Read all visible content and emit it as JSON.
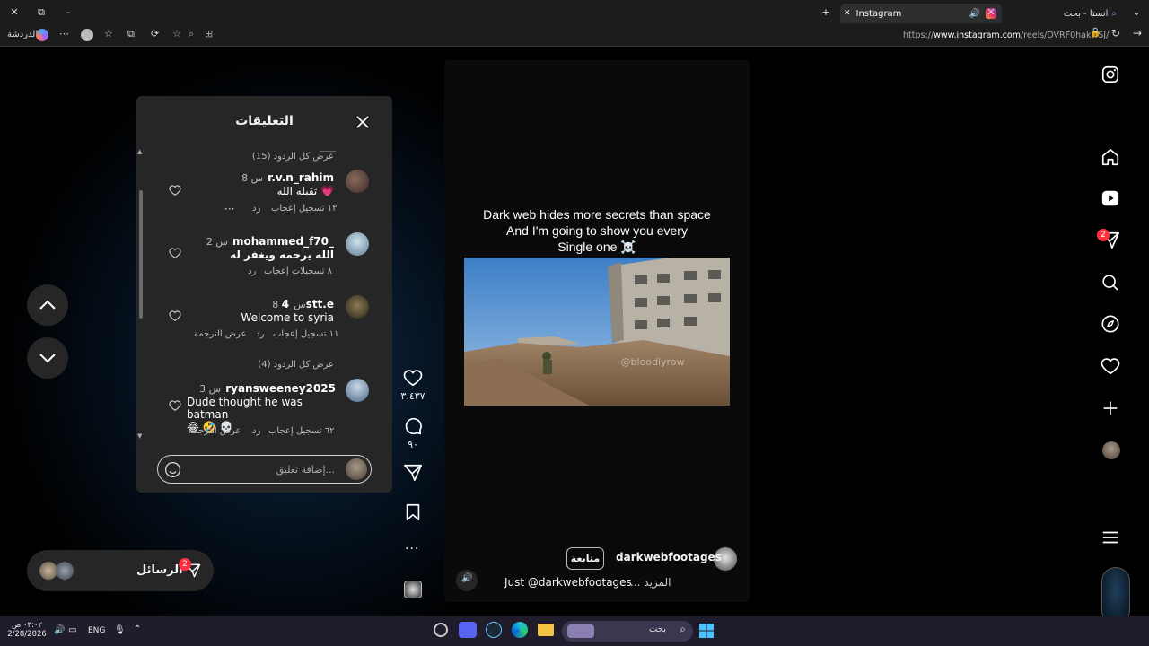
{
  "browser": {
    "tabs": [
      {
        "label": "Instagram"
      },
      {
        "label": "انستا - بحث"
      }
    ],
    "url_prefix": "https://",
    "url_domain": "www.instagram.com",
    "url_path": "/reels/DVRF0hakwSJ/",
    "chat_label": "الدردشة"
  },
  "comments_panel": {
    "title": "التعليقات",
    "view_replies_top": "عرض كل الردود (15)",
    "view_replies_mid": "عرض كل الردود (4)",
    "comments": [
      {
        "user": "r.v.n_rahim",
        "time": "8 س",
        "text": "تقبله الله 💗",
        "likes": "١٢ تسجيل إعجاب",
        "reply": "رد",
        "more": "···"
      },
      {
        "user": "mohammed_f70_",
        "time": "2 س",
        "text": "الله يرحمه ويغفر له",
        "likes": "٨ تسجيلات إعجاب",
        "reply": "رد"
      },
      {
        "user": "4stt.e",
        "time": "8 س",
        "text": "Welcome to syria",
        "likes": "١١ تسجيل إعجاب",
        "reply": "رد",
        "translate": "عرض الترجمة"
      },
      {
        "user": "ryansweeney2025",
        "time": "3 س",
        "text": "Dude thought he was batman",
        "emoji": "😂 🤣 💀",
        "likes": "٦٢ تسجيل إعجاب",
        "reply": "رد",
        "translate": "عرض الترجمة"
      }
    ],
    "input_placeholder": "إضافة تعليق..."
  },
  "reel": {
    "caption_lines": [
      "Dark web hides more secrets than space",
      "And I'm going to show you every",
      "Single one ☠️"
    ],
    "watermark": "@bloodlyrow",
    "author": "darkwebfootages",
    "follow_label": "متابعة",
    "description": "Just @darkwebfootages",
    "more_label": "... المزيد",
    "like_count": "٣،٤٣٧",
    "comment_count": "٩٠"
  },
  "messages": {
    "label": "الرسائل",
    "badge": "2"
  },
  "nav": {
    "notif_badge": "2"
  },
  "taskbar": {
    "search_placeholder": "بحث",
    "lang": "ENG",
    "time": "٠٣:٠٢ ص",
    "date": "2/28/2026"
  }
}
